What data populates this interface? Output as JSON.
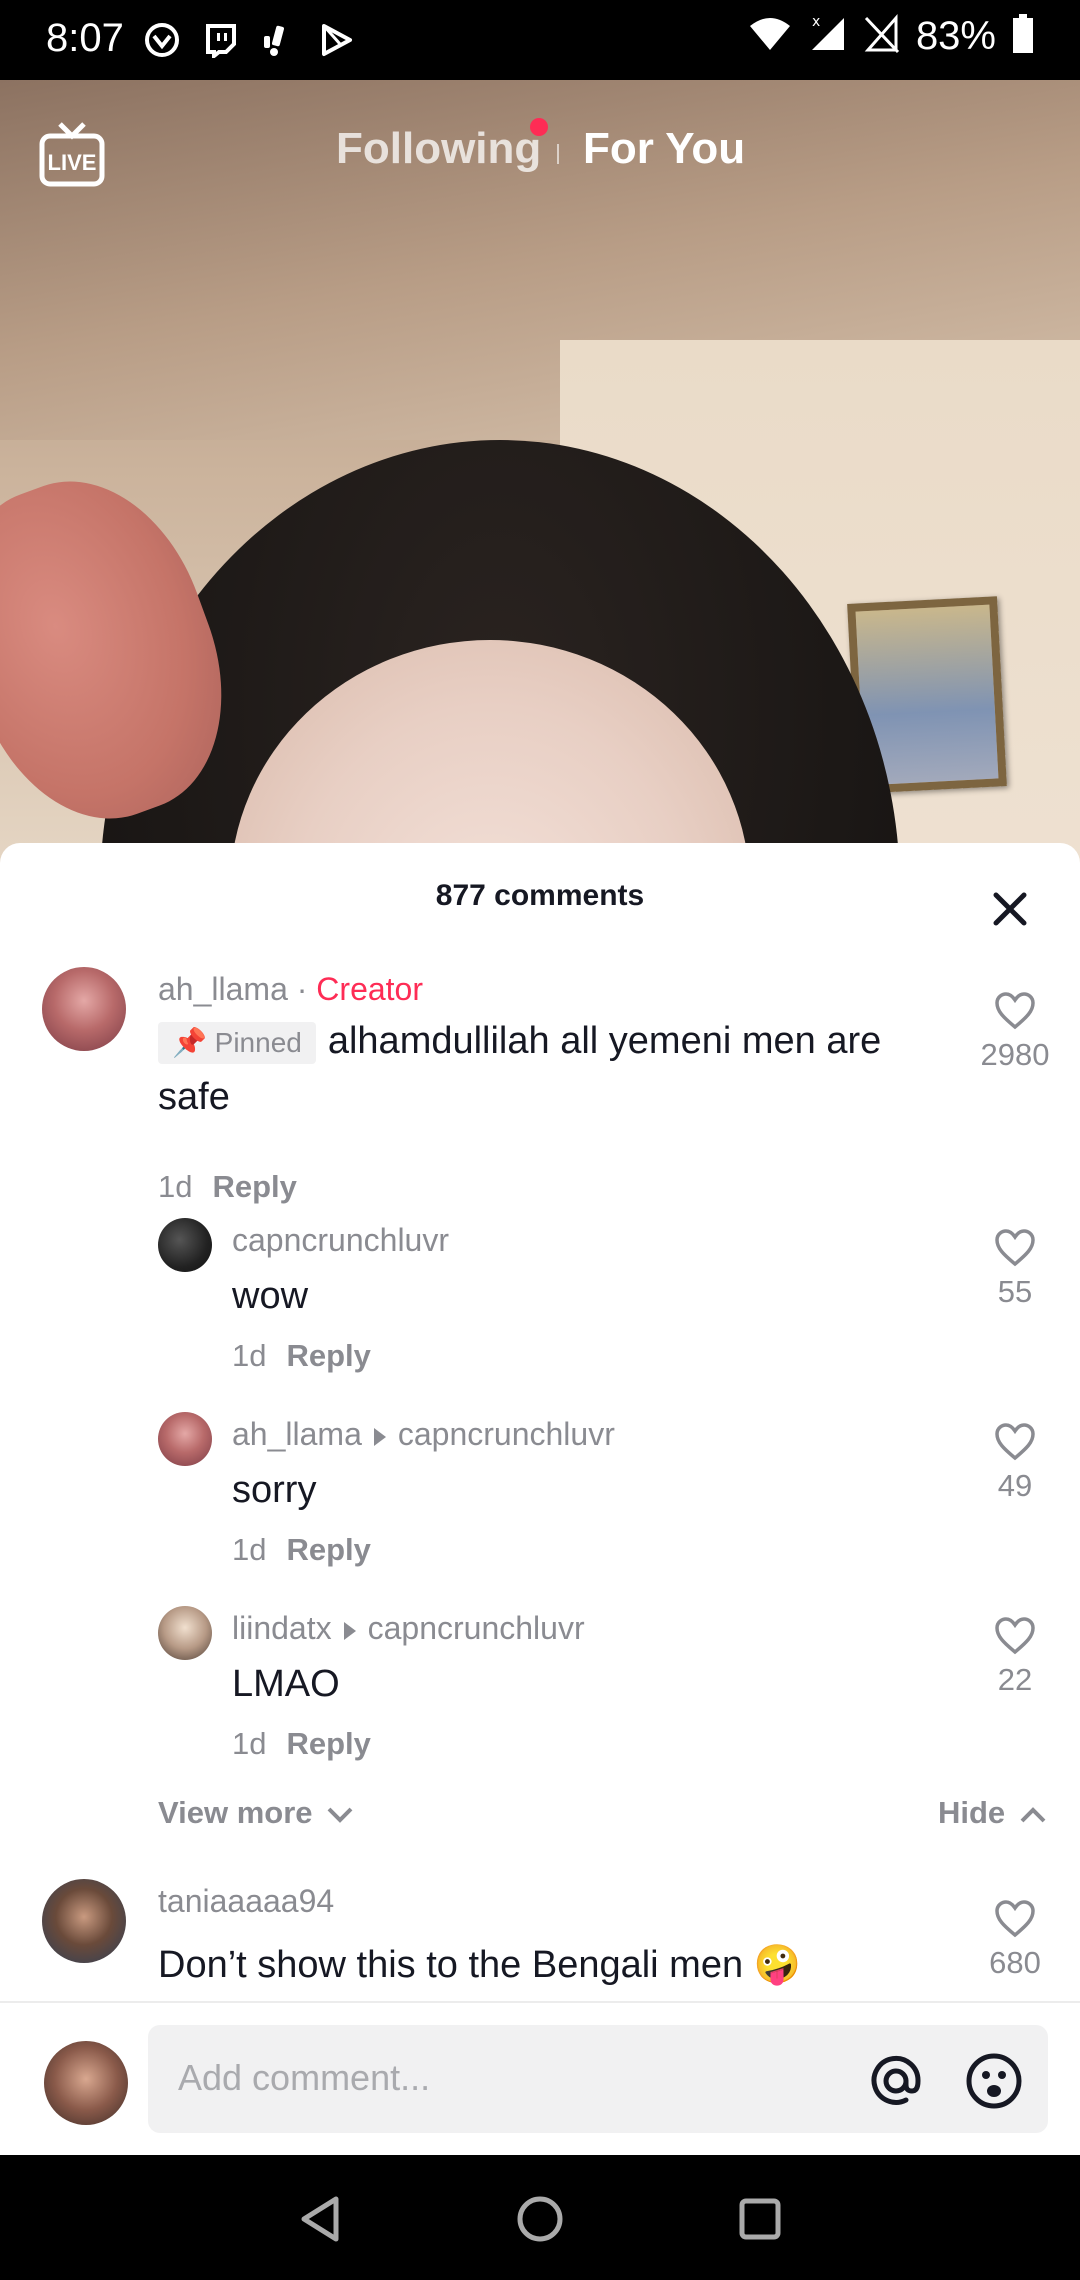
{
  "status": {
    "time": "8:07",
    "battery": "83%",
    "left_icons": [
      "vpn-icon",
      "twitch-icon",
      "notification-icon",
      "play-store-icon"
    ],
    "right_icons": [
      "wifi-icon",
      "signal-icon",
      "no-sim-icon",
      "battery-icon"
    ]
  },
  "header": {
    "live_label": "LIVE",
    "tab_following": "Following",
    "tab_for_you": "For You"
  },
  "comments_sheet": {
    "title": "877 comments",
    "pinned_comment": {
      "username": "ah_llama",
      "creator_tag": "Creator",
      "separator": "·",
      "pinned_label": "Pinned",
      "text": "alhamdullilah all yemeni men are safe",
      "age": "1d",
      "reply_label": "Reply",
      "likes": "2980"
    },
    "replies": [
      {
        "username": "capncrunchluvr",
        "reply_to": "",
        "text": "wow",
        "age": "1d",
        "reply_label": "Reply",
        "likes": "55"
      },
      {
        "username": "ah_llama",
        "reply_to": "capncrunchluvr",
        "text": "sorry",
        "age": "1d",
        "reply_label": "Reply",
        "likes": "49"
      },
      {
        "username": "liindatx",
        "reply_to": "capncrunchluvr",
        "text": "LMAO",
        "age": "1d",
        "reply_label": "Reply",
        "likes": "22"
      }
    ],
    "view_more": "View more",
    "hide": "Hide",
    "next_comment": {
      "username": "taniaaaaa94",
      "text": "Don’t show this to the Bengali men 🤪",
      "likes": "680"
    },
    "input_placeholder": "Add comment..."
  },
  "colors": {
    "accent": "#fe2c55",
    "muted_text": "#8a8b91",
    "primary_text": "#161823"
  }
}
